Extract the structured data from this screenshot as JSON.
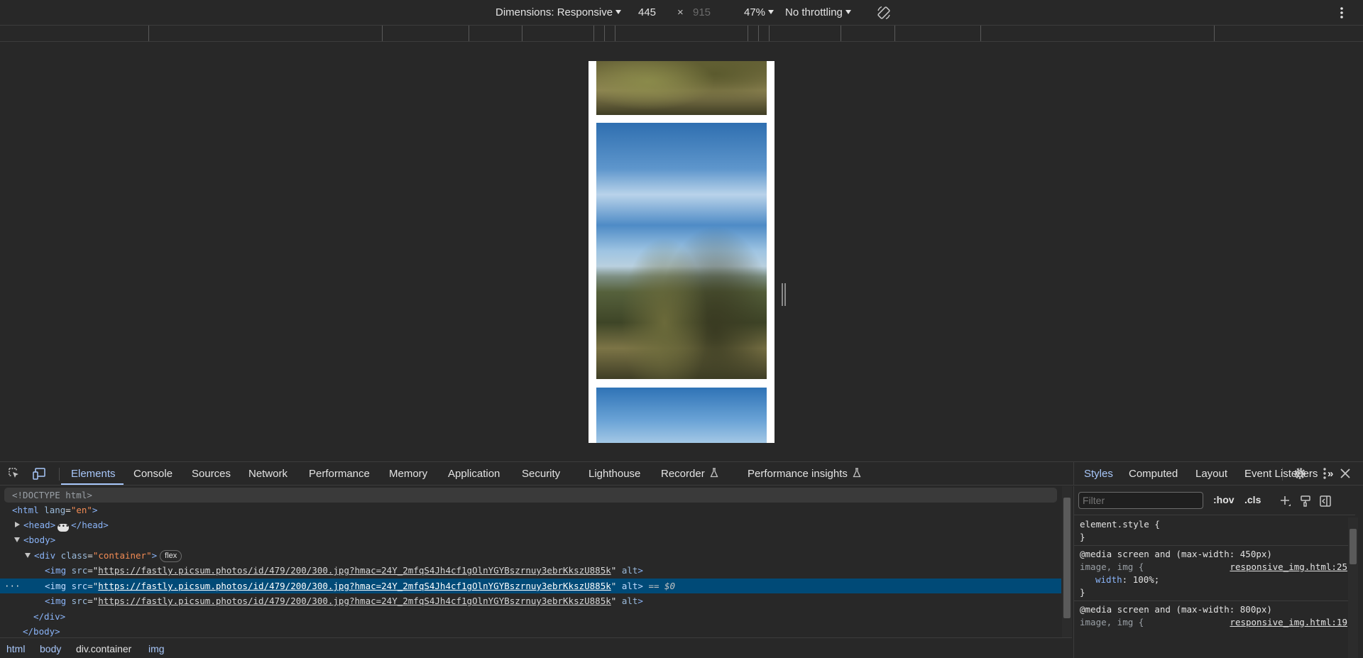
{
  "device_toolbar": {
    "dimensions_label": "Dimensions: Responsive",
    "width": "445",
    "separator": "×",
    "height_placeholder": "915",
    "zoom": "47%",
    "throttling": "No throttling",
    "rotate_icon": "rotate-icon",
    "more_icon": "more-vert-icon"
  },
  "devtools": {
    "tabs": [
      "Elements",
      "Console",
      "Sources",
      "Network",
      "Performance",
      "Memory",
      "Application",
      "Security",
      "Lighthouse",
      "Recorder",
      "Performance insights"
    ],
    "active_tab": "Elements"
  },
  "dom": {
    "doctype": "<!DOCTYPE html>",
    "html_open": "<html",
    "html_attr": "lang",
    "html_attr_val": "\"en\"",
    "html_close": ">",
    "head_open": "<head>",
    "head_close": "</head>",
    "body": "<body>",
    "div_open": "<div",
    "div_attr": "class",
    "div_attr_val": "\"container\"",
    "div_close_bracket": ">",
    "flex_badge": "flex",
    "img_open": "<img",
    "img_attr": "src",
    "img_src": "https://fastly.picsum.photos/id/479/200/300.jpg?hmac=24Y_2mfqS4Jh4cf1gOlnYGYBszrnuy3ebrKkszU885k",
    "img_alt": "alt",
    "img_end": ">",
    "selected_ref": "== $0",
    "div_close": "</div>",
    "body_close": "</body>"
  },
  "breadcrumbs": [
    "html",
    "body",
    "div.container",
    "img"
  ],
  "styles": {
    "tabs": [
      "Styles",
      "Computed",
      "Layout",
      "Event Listeners"
    ],
    "active_tab": "Styles",
    "filter_placeholder": "Filter",
    "hov": ":hov",
    "cls": ".cls",
    "element_style": "element.style {",
    "close_brace": "}",
    "rule1_media": "@media screen and (max-width: 450px)",
    "rule1_selector": "image, img {",
    "rule1_source": "responsive_img.html:25",
    "rule1_prop": "width",
    "rule1_val": ": 100%;",
    "rule2_media": "@media screen and (max-width: 800px)",
    "rule2_selector": "image, img {",
    "rule2_source": "responsive_img.html:19"
  }
}
